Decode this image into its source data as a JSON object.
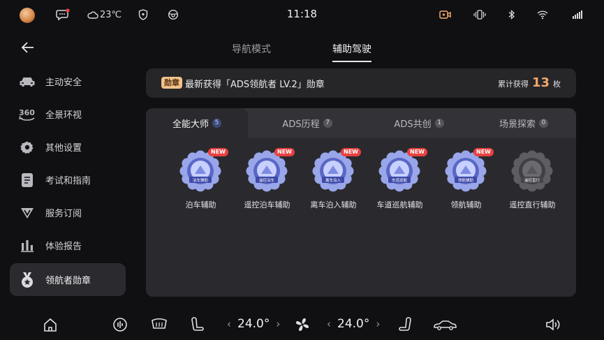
{
  "status_bar": {
    "weather": "23℃",
    "time": "11:18"
  },
  "sidebar": {
    "items": [
      {
        "label": "主动安全",
        "icon": "car-icon"
      },
      {
        "label": "全景环视",
        "icon": "360-view-icon",
        "icon_text": "360"
      },
      {
        "label": "其他设置",
        "icon": "gear-icon"
      },
      {
        "label": "考试和指南",
        "icon": "document-icon"
      },
      {
        "label": "服务订阅",
        "icon": "subscription-v-icon"
      },
      {
        "label": "体验报告",
        "icon": "bar-chart-icon"
      },
      {
        "label": "领航者勋章",
        "icon": "medal-icon",
        "active": true
      }
    ]
  },
  "top_tabs": [
    {
      "label": "导航模式",
      "active": false
    },
    {
      "label": "辅助驾驶",
      "active": true
    }
  ],
  "banner": {
    "badge": "勋章",
    "text": "最新获得「ADS领航者 LV.2」勋章",
    "total_label": "累计获得",
    "total_count": "13",
    "total_unit": "枚"
  },
  "sub_tabs": [
    {
      "label": "全能大师",
      "count": "5",
      "active": true
    },
    {
      "label": "ADS历程",
      "count": "7",
      "active": false
    },
    {
      "label": "ADS共创",
      "count": "1",
      "active": false
    },
    {
      "label": "场景探索",
      "count": "0",
      "active": false
    }
  ],
  "medals": [
    {
      "label": "泊车辅助",
      "ribbon": "泊车辅助",
      "new_tag": "NEW",
      "unlocked": true
    },
    {
      "label": "遥控泊车辅助",
      "ribbon": "遥控泊车",
      "new_tag": "NEW",
      "unlocked": true
    },
    {
      "label": "离车泊入辅助",
      "ribbon": "离车泊入",
      "new_tag": "NEW",
      "unlocked": true
    },
    {
      "label": "车道巡航辅助",
      "ribbon": "车道巡航",
      "new_tag": "NEW",
      "unlocked": true
    },
    {
      "label": "领航辅助",
      "ribbon": "领航辅助",
      "new_tag": "NEW",
      "unlocked": true
    },
    {
      "label": "遥控直行辅助",
      "ribbon": "遥控直行",
      "new_tag": "",
      "unlocked": false
    }
  ],
  "dock": {
    "left_temp": "24.0°",
    "right_temp": "24.0°"
  },
  "colors": {
    "background": "#101012",
    "panel": "#2a2a2e",
    "accent_orange": "#f3a86a",
    "new_red": "#e8413f",
    "medal_blue": "#6f7fd6"
  }
}
